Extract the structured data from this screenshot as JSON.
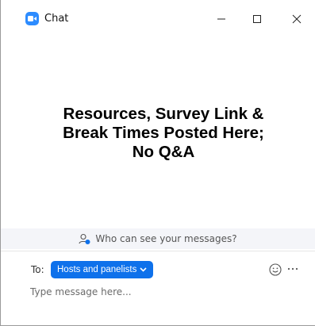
{
  "window": {
    "title": "Chat",
    "controls": [
      "minimize",
      "maximize",
      "close"
    ]
  },
  "chat": {
    "announcement_lines": [
      "Resources, Survey Link &",
      "Break Times Posted Here;",
      "No Q&A"
    ]
  },
  "privacy": {
    "text": "Who can see your messages?",
    "icon": "user-visibility-icon"
  },
  "composer": {
    "to_label": "To:",
    "recipient": "Hosts and panelists",
    "placeholder": "Type message here...",
    "icons": [
      "emoji-icon",
      "more-options-icon"
    ]
  },
  "colors": {
    "accent": "#0e71eb",
    "app_icon": "#2d8cff",
    "privacy_bg": "#f4f5f9"
  }
}
